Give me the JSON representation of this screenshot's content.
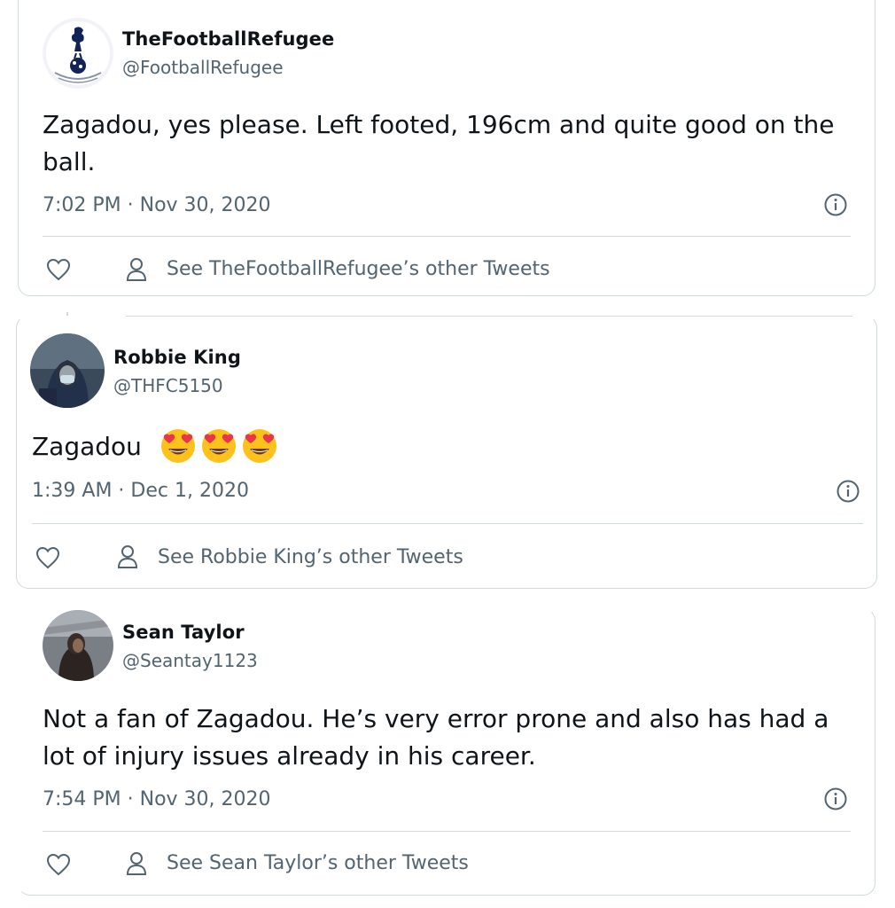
{
  "tweets": [
    {
      "display_name": "TheFootballRefugee",
      "handle": "@FootballRefugee",
      "text": "Zagadou, yes please. Left footed, 196cm and quite good on the ball.",
      "timestamp": "7:02 PM · Nov 30, 2020",
      "see_other": "See TheFootballRefugee’s other Tweets",
      "avatar_icon": "tottenham-crest"
    },
    {
      "display_name": "Robbie King",
      "handle": "@THFC5150",
      "text": "Zagadou",
      "emoji": [
        "heart-eyes-emoji",
        "heart-eyes-emoji",
        "heart-eyes-emoji"
      ],
      "timestamp": "1:39 AM · Dec 1, 2020",
      "see_other": "See Robbie King’s other Tweets",
      "avatar_icon": "hooded-person-photo"
    },
    {
      "display_name": "Sean Taylor",
      "handle": "@Seantay1123",
      "text": "Not a fan of Zagadou. He’s very error prone and also has had a lot of injury issues already in his career.",
      "timestamp": "7:54 PM · Nov 30, 2020",
      "see_other": "See Sean Taylor’s other Tweets",
      "avatar_icon": "person-photo"
    }
  ],
  "colors": {
    "text_primary": "#0f1419",
    "text_secondary": "#536471",
    "border": "#cfd9de",
    "emoji_yellow": "#fcc21b",
    "emoji_heart": "#e8354b"
  }
}
